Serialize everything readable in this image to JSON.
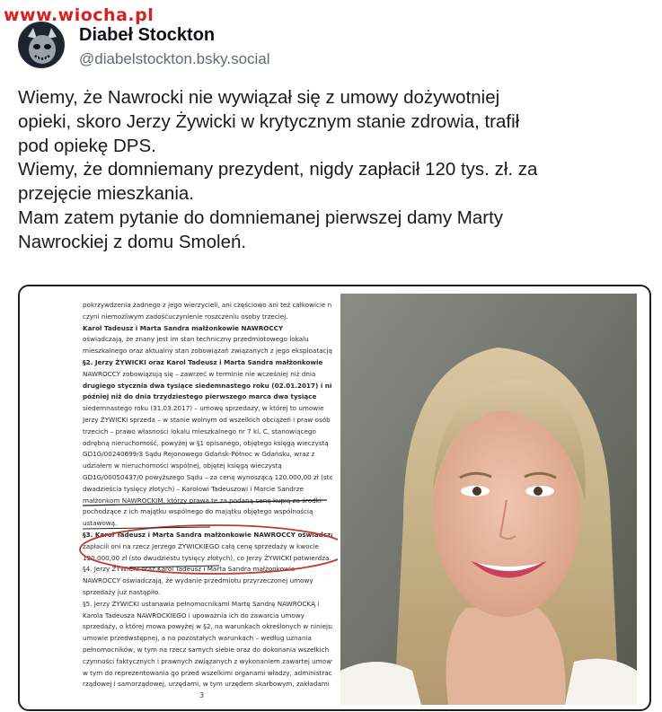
{
  "watermark": "www.wiocha.pl",
  "author": {
    "name": "Diabeł Stockton",
    "handle": "@diabelstockton.bsky.social",
    "avatar_icon": "devil-mask-avatar-icon"
  },
  "post": {
    "lines": [
      "Wiemy, że Nawrocki nie wywiązał się z umowy dożywotniej",
      "opieki, skoro Jerzy Żywicki w krytycznym stanie zdrowia, trafił",
      "pod opiekę DPS.",
      "Wiemy, że domniemany prezydent, nigdy zapłacił 120 tys. zł. za",
      "przejęcie mieszkania.",
      "Mam zatem pytanie do domniemanej pierwszej damy Marty",
      "Nawrockiej z domu Smoleń."
    ]
  },
  "document": {
    "lines": [
      "pokrzywdzenia żadnego z jego wierzycieli, ani częściowo ani też całkowicie nie",
      "czyni niemożliwym zadośćuczynienie roszczeniu osoby trzeciej.",
      "Karol Tadeusz i Marta Sandra małżonkowie NAWROCCY",
      "oświadczają, że znany jest im stan techniczny przedmiotowego lokalu",
      "mieszkalnego oraz aktualny stan zobowiązań związanych z jego eksploatacją.",
      "§2. Jerzy ŻYWICKI oraz Karol Tadeusz i Marta Sandra małżonkowie",
      "NAWROCCY zobowiązują się – zawrzeć w terminie nie wcześniej niż dnia",
      "drugiego stycznia dwa tysiące siedemnastego roku (02.01.2017) i nie",
      "później niż do dnia trzydziestego pierwszego marca dwa tysiące",
      "siedemnastego roku (31.03.2017) – umowę sprzedaży, w której to umowie",
      "Jerzy ŻYWICKI sprzeda – w stanie wolnym od wszelkich obciążeń i praw osób",
      "trzecich – prawo własności lokalu mieszkalnego nr 7 kl. C, stanowiącego",
      "odrębną nieruchomość, powyżej w §1 opisanego, objętego księgą wieczystą",
      "GD1G/00240699/3 Sądu Rejonowego Gdańsk-Północ w Gdańsku, wraz z",
      "udziałem w nieruchomości wspólnej, objętej księgą wieczystą",
      "GD1G/00050437/0 powyższego Sądu – za cenę wynoszącą 120.000,00 zł (sto",
      "dwadzieścia tysięcy złotych) – Karolowi Tadeuszowi i Marcie Sandrze",
      "małżonkom NAWROCKIM, którzy prawa te za podaną cenę kupią za środki",
      "pochodzące z ich majątku wspólnego do majątku objętego wspólnością",
      "ustawową.",
      "§3. Karol Tadeusz i Marta Sandra małżonkowie NAWROCCY oświadczają, że",
      "zapłacili oni na rzecz Jerzego ŻYWICKIEGO całą cenę sprzedaży w kwocie",
      "120.000,00 zł (sto dwudziestu tysięcy złotych), co Jerzy ŻYWICKI potwierdza.",
      "§4. Jerzy ŻYWICKI oraz Karol Tadeusz i Marta Sandra małżonkowie",
      "NAWROCCY oświadczają, że wydanie przedmiotu przyrzeczonej umowy",
      "sprzedaży już nastąpiło.",
      "§5. Jerzy ŻYWICKI ustanawia pełnomocnikami Martę Sandrę NAWROCKĄ i",
      "Karola Tadeusza NAWROCKIEGO i upoważnia ich do zawarcia umowy",
      "sprzedaży, o której mowa powyżej w §2, na warunkach określonych w niniejszej",
      "umowie przedwstępnej, a na pozostałych warunkach – według uznania",
      "pełnomocników, w tym na rzecz samych siebie oraz do dokonania wszelkich",
      "czynności faktycznych i prawnych związanych z wykonaniem zawartej umowy,",
      "w tym do reprezentowania go przed wszelkimi organami władzy, administracji",
      "rządowej i samorządowej, urzędami, w tym urzędem skarbowym, zakładami"
    ],
    "page_number": "3",
    "highlight_color": "#c23a2a"
  }
}
